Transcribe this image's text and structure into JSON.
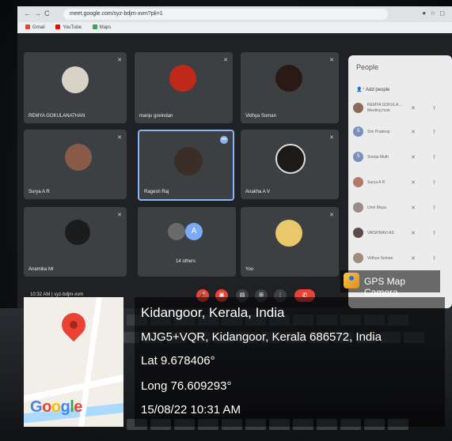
{
  "meet": {
    "browser_url": "meet.google.com/syz-bdjm-xvm?pli=1",
    "bookmarks": [
      "Gmail",
      "YouTube",
      "Maps"
    ],
    "tiles": [
      {
        "name": "REMYA GOKULANATHAN"
      },
      {
        "name": "manju govindan"
      },
      {
        "name": "Vidhya Soman"
      },
      {
        "name": "Surya A R"
      },
      {
        "name": "Ragesh Raj"
      },
      {
        "name": "Anakha A V"
      },
      {
        "name": "Anamika Mr"
      },
      {
        "name": "14 others",
        "avatar_letter": "A"
      },
      {
        "name": "You"
      }
    ],
    "people_panel": {
      "title": "People",
      "add_label": "Add people",
      "entries": [
        {
          "name": "REMYA GOKULA...",
          "sub": "Meeting host"
        },
        {
          "name": "Sini Pradeep",
          "avatar_letter": "S"
        },
        {
          "name": "Sreeja Muth",
          "avatar_letter": "S"
        },
        {
          "name": "Surya A R"
        },
        {
          "name": "Unni Maya"
        },
        {
          "name": "VAISHNAVI AS"
        },
        {
          "name": "Vidhya Soman"
        }
      ]
    },
    "meeting_time": "10:32 AM",
    "meeting_code": "syz-bdjm-xvm"
  },
  "gps_overlay": {
    "app_name": "GPS Map Camera",
    "place": "Kidangoor, Kerala, India",
    "address": "MJG5+VQR, Kidangoor, Kerala 686572, India",
    "lat": "Lat 9.678406°",
    "long": "Long 76.609293°",
    "datetime": "15/08/22 10:31 AM",
    "map_logo": "Google"
  }
}
